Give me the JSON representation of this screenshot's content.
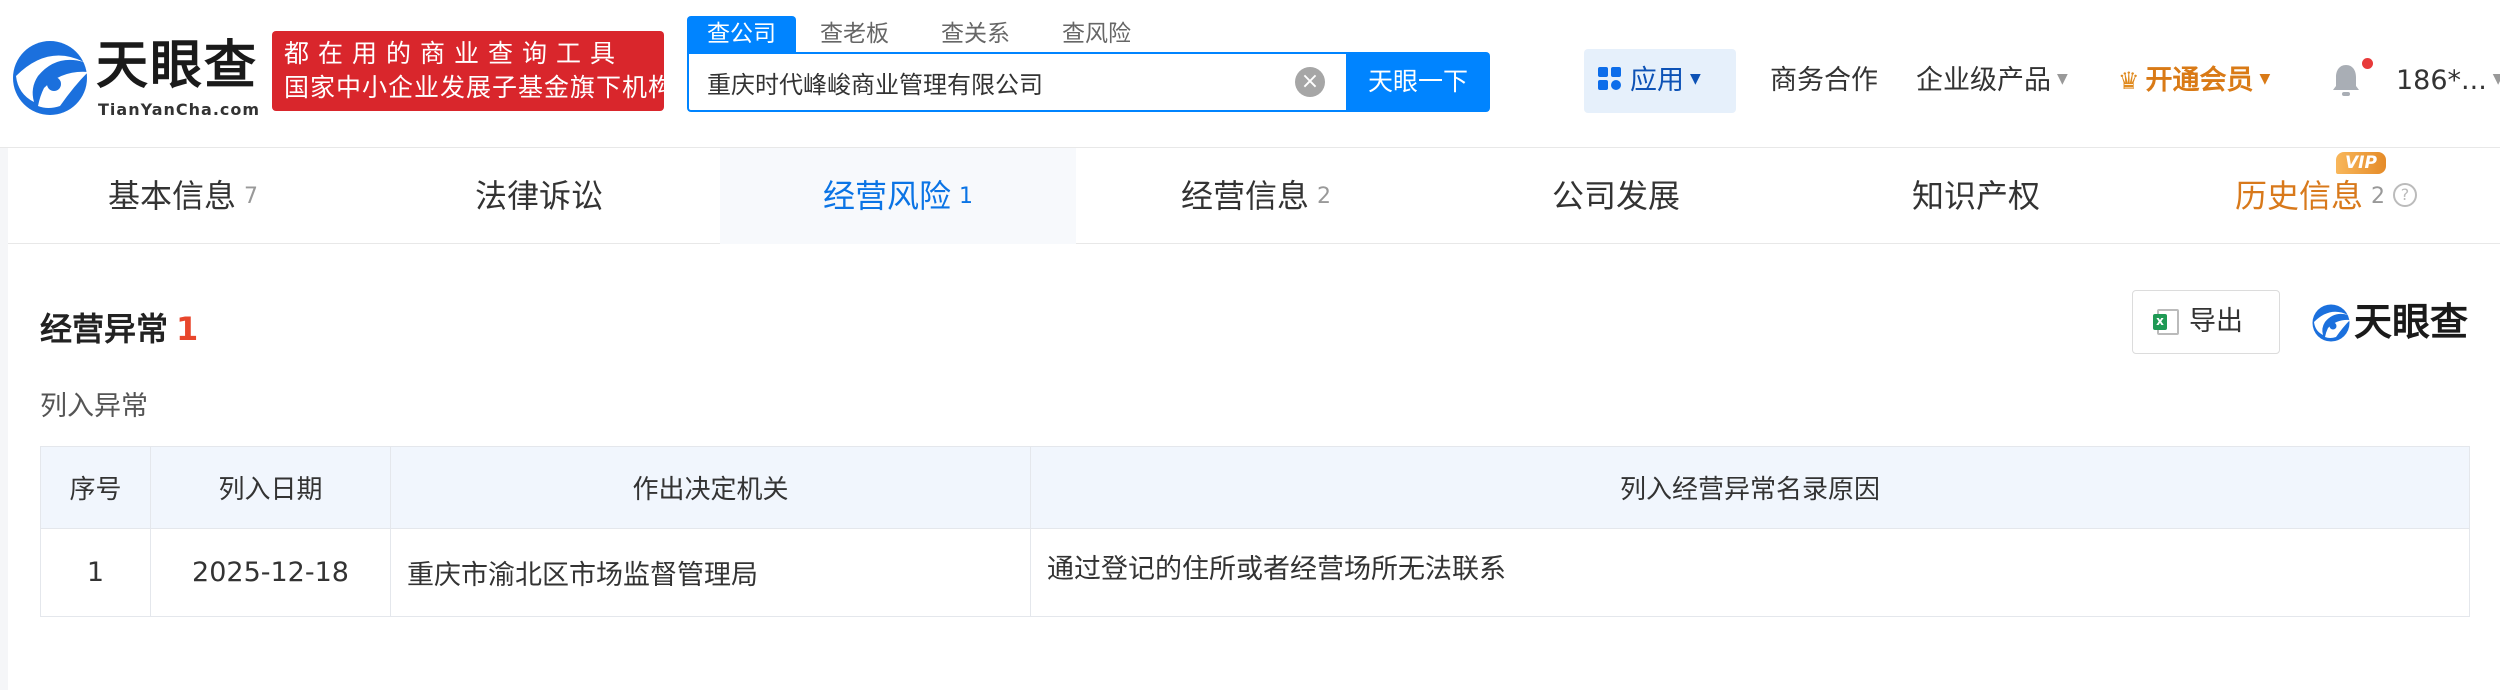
{
  "header": {
    "logo_text": "天眼查",
    "logo_sub": "TianYanCha.com",
    "slogan_line1": "都在用的商业查询工具",
    "slogan_line2": "国家中小企业发展子基金旗下机构",
    "search_tabs": [
      "查公司",
      "查老板",
      "查关系",
      "查风险"
    ],
    "search_value": "重庆时代峰峻商业管理有限公司",
    "search_button": "天眼一下",
    "clear_glyph": "×",
    "nav": {
      "app": "应用",
      "business": "商务合作",
      "enterprise": "企业级产品",
      "vip": "开通会员",
      "user": "186*..."
    }
  },
  "tabs": [
    {
      "label": "基本信息",
      "count": "7"
    },
    {
      "label": "法律诉讼",
      "count": ""
    },
    {
      "label": "经营风险",
      "count": "1"
    },
    {
      "label": "经营信息",
      "count": "2"
    },
    {
      "label": "公司发展",
      "count": ""
    },
    {
      "label": "知识产权",
      "count": ""
    },
    {
      "label": "历史信息",
      "count": "2"
    }
  ],
  "vip_badge": "VIP",
  "section": {
    "title": "经营异常",
    "count": "1",
    "export_label": "导出",
    "watermark": "天眼查",
    "subtitle": "列入异常",
    "columns": [
      "序号",
      "列入日期",
      "作出决定机关",
      "列入经营异常名录原因"
    ],
    "rows": [
      [
        "1",
        "2025-12-18",
        "重庆市渝北区市场监督管理局",
        "通过登记的住所或者经营场所无法联系"
      ]
    ]
  },
  "colors": {
    "brand_blue": "#0084ff",
    "slogan_red": "#d9262c",
    "active_tab": "#0b74e5",
    "vip_orange": "#d8791b",
    "count_red": "#e8462c"
  }
}
